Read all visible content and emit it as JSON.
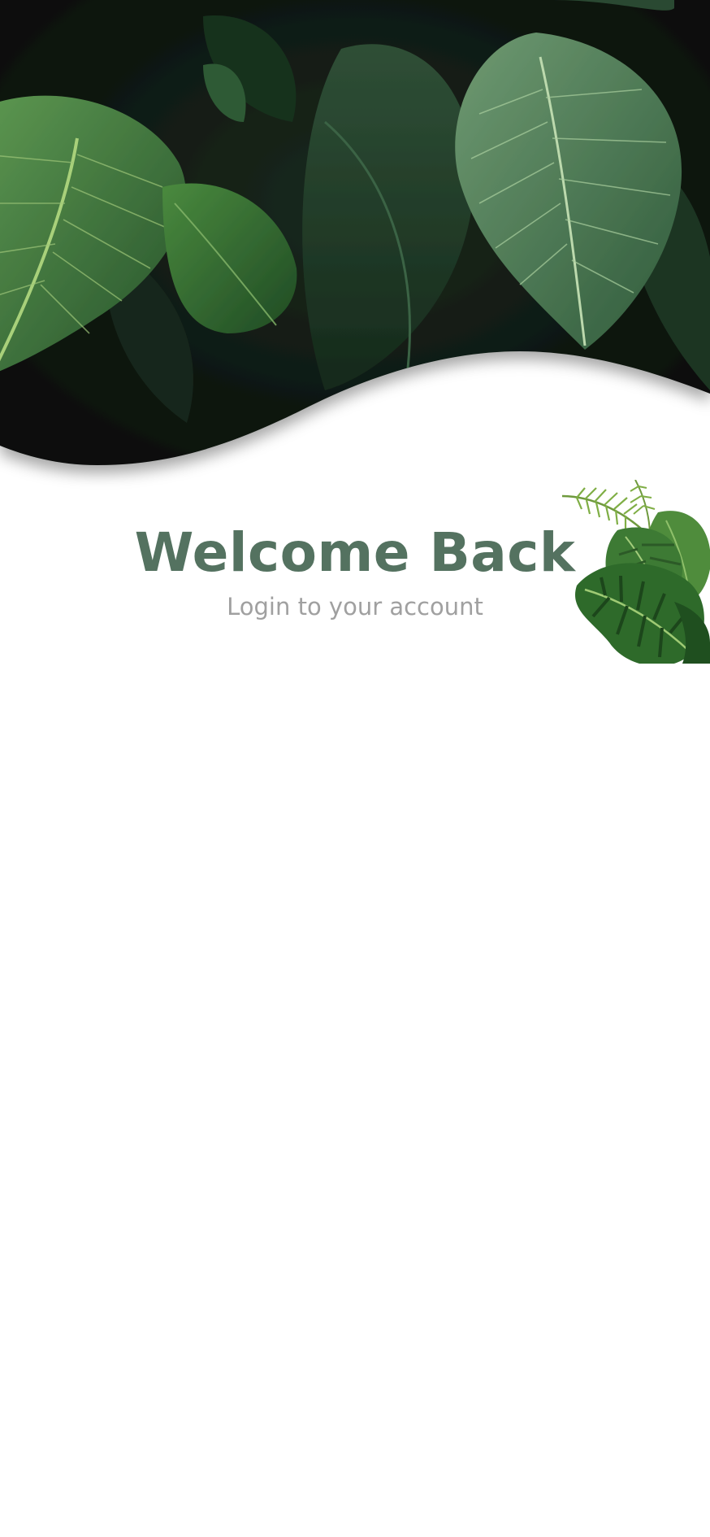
{
  "login": {
    "title": "Welcome Back",
    "subtitle": "Login to your account"
  },
  "theme": {
    "title_color": "#547260",
    "subtitle_color": "#a0a0a0",
    "hero_dark": "#0c120e",
    "leaf_green": "#3f7a3d"
  },
  "images": {
    "hero": "tropical-leaves-header-image",
    "decoration": "monstera-palm-leaf-decoration"
  }
}
